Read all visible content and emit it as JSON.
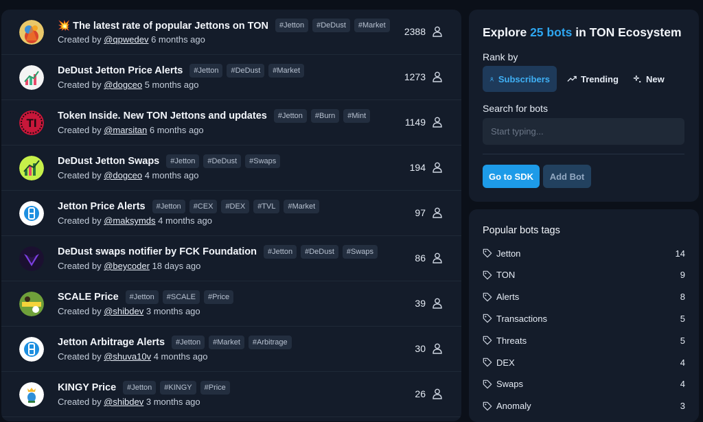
{
  "bots": [
    {
      "prefix": "💥 ",
      "name": "The latest rate of popular Jettons on TON",
      "tags": [
        "#Jetton",
        "#DeDust",
        "#Market"
      ],
      "created_label": "Created by",
      "author": "@qpwedev",
      "age": "6 months ago",
      "subscribers": "2388",
      "avatar": "fire-cartoon-avatar"
    },
    {
      "prefix": "",
      "name": "DeDust Jetton Price Alerts",
      "tags": [
        "#Jetton",
        "#DeDust",
        "#Market"
      ],
      "created_label": "Created by",
      "author": "@dogceo",
      "age": "5 months ago",
      "subscribers": "1273",
      "avatar": "chart-avatar"
    },
    {
      "prefix": "",
      "name": "Token Inside. New TON Jettons and updates",
      "tags": [
        "#Jetton",
        "#Burn",
        "#Mint"
      ],
      "created_label": "Created by",
      "author": "@marsitan",
      "age": "6 months ago",
      "subscribers": "1149",
      "avatar": "ti-logo-avatar"
    },
    {
      "prefix": "",
      "name": "DeDust Jetton Swaps",
      "tags": [
        "#Jetton",
        "#DeDust",
        "#Swaps"
      ],
      "created_label": "Created by",
      "author": "@dogceo",
      "age": "4 months ago",
      "subscribers": "194",
      "avatar": "green-chart-avatar"
    },
    {
      "prefix": "",
      "name": "Jetton Price Alerts",
      "tags": [
        "#Jetton",
        "#CEX",
        "#DEX",
        "#TVL",
        "#Market"
      ],
      "created_label": "Created by",
      "author": "@maksymds",
      "age": "4 months ago",
      "subscribers": "97",
      "avatar": "blue-b-avatar"
    },
    {
      "prefix": "",
      "name": "DeDust swaps notifier by FCK Foundation",
      "tags": [
        "#Jetton",
        "#DeDust",
        "#Swaps"
      ],
      "created_label": "Created by",
      "author": "@beycoder",
      "age": "18 days ago",
      "subscribers": "86",
      "avatar": "purple-y-avatar"
    },
    {
      "prefix": "",
      "name": "SCALE Price",
      "tags": [
        "#Jetton",
        "#SCALE",
        "#Price"
      ],
      "created_label": "Created by",
      "author": "@shibdev",
      "age": "3 months ago",
      "subscribers": "39",
      "avatar": "scale-avatar"
    },
    {
      "prefix": "",
      "name": "Jetton Arbitrage Alerts",
      "tags": [
        "#Jetton",
        "#Market",
        "#Arbitrage"
      ],
      "created_label": "Created by",
      "author": "@shuva10v",
      "age": "4 months ago",
      "subscribers": "30",
      "avatar": "blue-b-avatar"
    },
    {
      "prefix": "",
      "name": "KINGY Price",
      "tags": [
        "#Jetton",
        "#KINGY",
        "#Price"
      ],
      "created_label": "Created by",
      "author": "@shibdev",
      "age": "3 months ago",
      "subscribers": "26",
      "avatar": "kingy-avatar"
    }
  ],
  "explore": {
    "title_prefix": "Explore ",
    "title_accent": "25 bots",
    "title_suffix": " in TON Ecosystem",
    "rank_label": "Rank by",
    "rank_options": [
      "Subscribers",
      "Trending",
      "New"
    ],
    "search_label": "Search for bots",
    "search_placeholder": "Start typing...",
    "sdk_button": "Go to SDK",
    "add_button": "Add Bot",
    "accent_color": "#2ea6f0"
  },
  "popular_tags": {
    "title": "Popular bots tags",
    "items": [
      {
        "name": "Jetton",
        "count": "14"
      },
      {
        "name": "TON",
        "count": "9"
      },
      {
        "name": "Alerts",
        "count": "8"
      },
      {
        "name": "Transactions",
        "count": "5"
      },
      {
        "name": "Threats",
        "count": "5"
      },
      {
        "name": "DEX",
        "count": "4"
      },
      {
        "name": "Swaps",
        "count": "4"
      },
      {
        "name": "Anomaly",
        "count": "3"
      }
    ]
  }
}
